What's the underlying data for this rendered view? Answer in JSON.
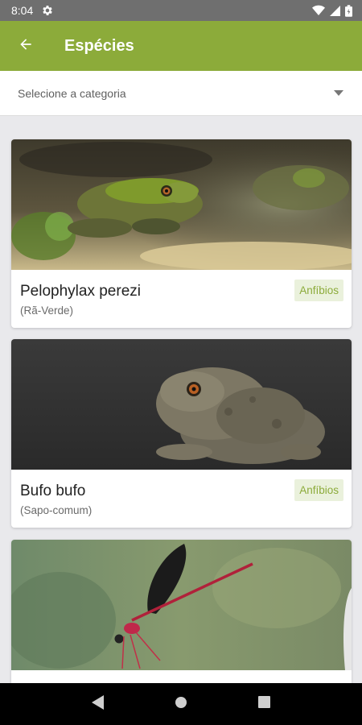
{
  "status_bar": {
    "time": "8:04"
  },
  "app_bar": {
    "title": "Espécies"
  },
  "category_select": {
    "placeholder": "Selecione a categoria"
  },
  "species": [
    {
      "scientific_name": "Pelophylax perezi",
      "common_name": "(Rã-Verde)",
      "category": "Anfíbios"
    },
    {
      "scientific_name": "Bufo bufo",
      "common_name": "(Sapo-comum)",
      "category": "Anfíbios"
    },
    {
      "scientific_name": "",
      "common_name": "",
      "category": ""
    }
  ],
  "icons": {
    "status": [
      "settings-gear-icon",
      "wifi-icon",
      "signal-icon",
      "battery-icon"
    ],
    "app_bar": "arrow-back-icon",
    "dropdown": "dropdown-arrow-icon",
    "nav": [
      "back-triangle-icon",
      "home-circle-icon",
      "recents-square-icon"
    ]
  },
  "colors": {
    "app_bar": "#8cab3a",
    "status_bar": "#6f6f6f",
    "badge_bg": "#eaf1dc",
    "badge_text": "#8cab3a",
    "background": "#e9e9ec"
  }
}
